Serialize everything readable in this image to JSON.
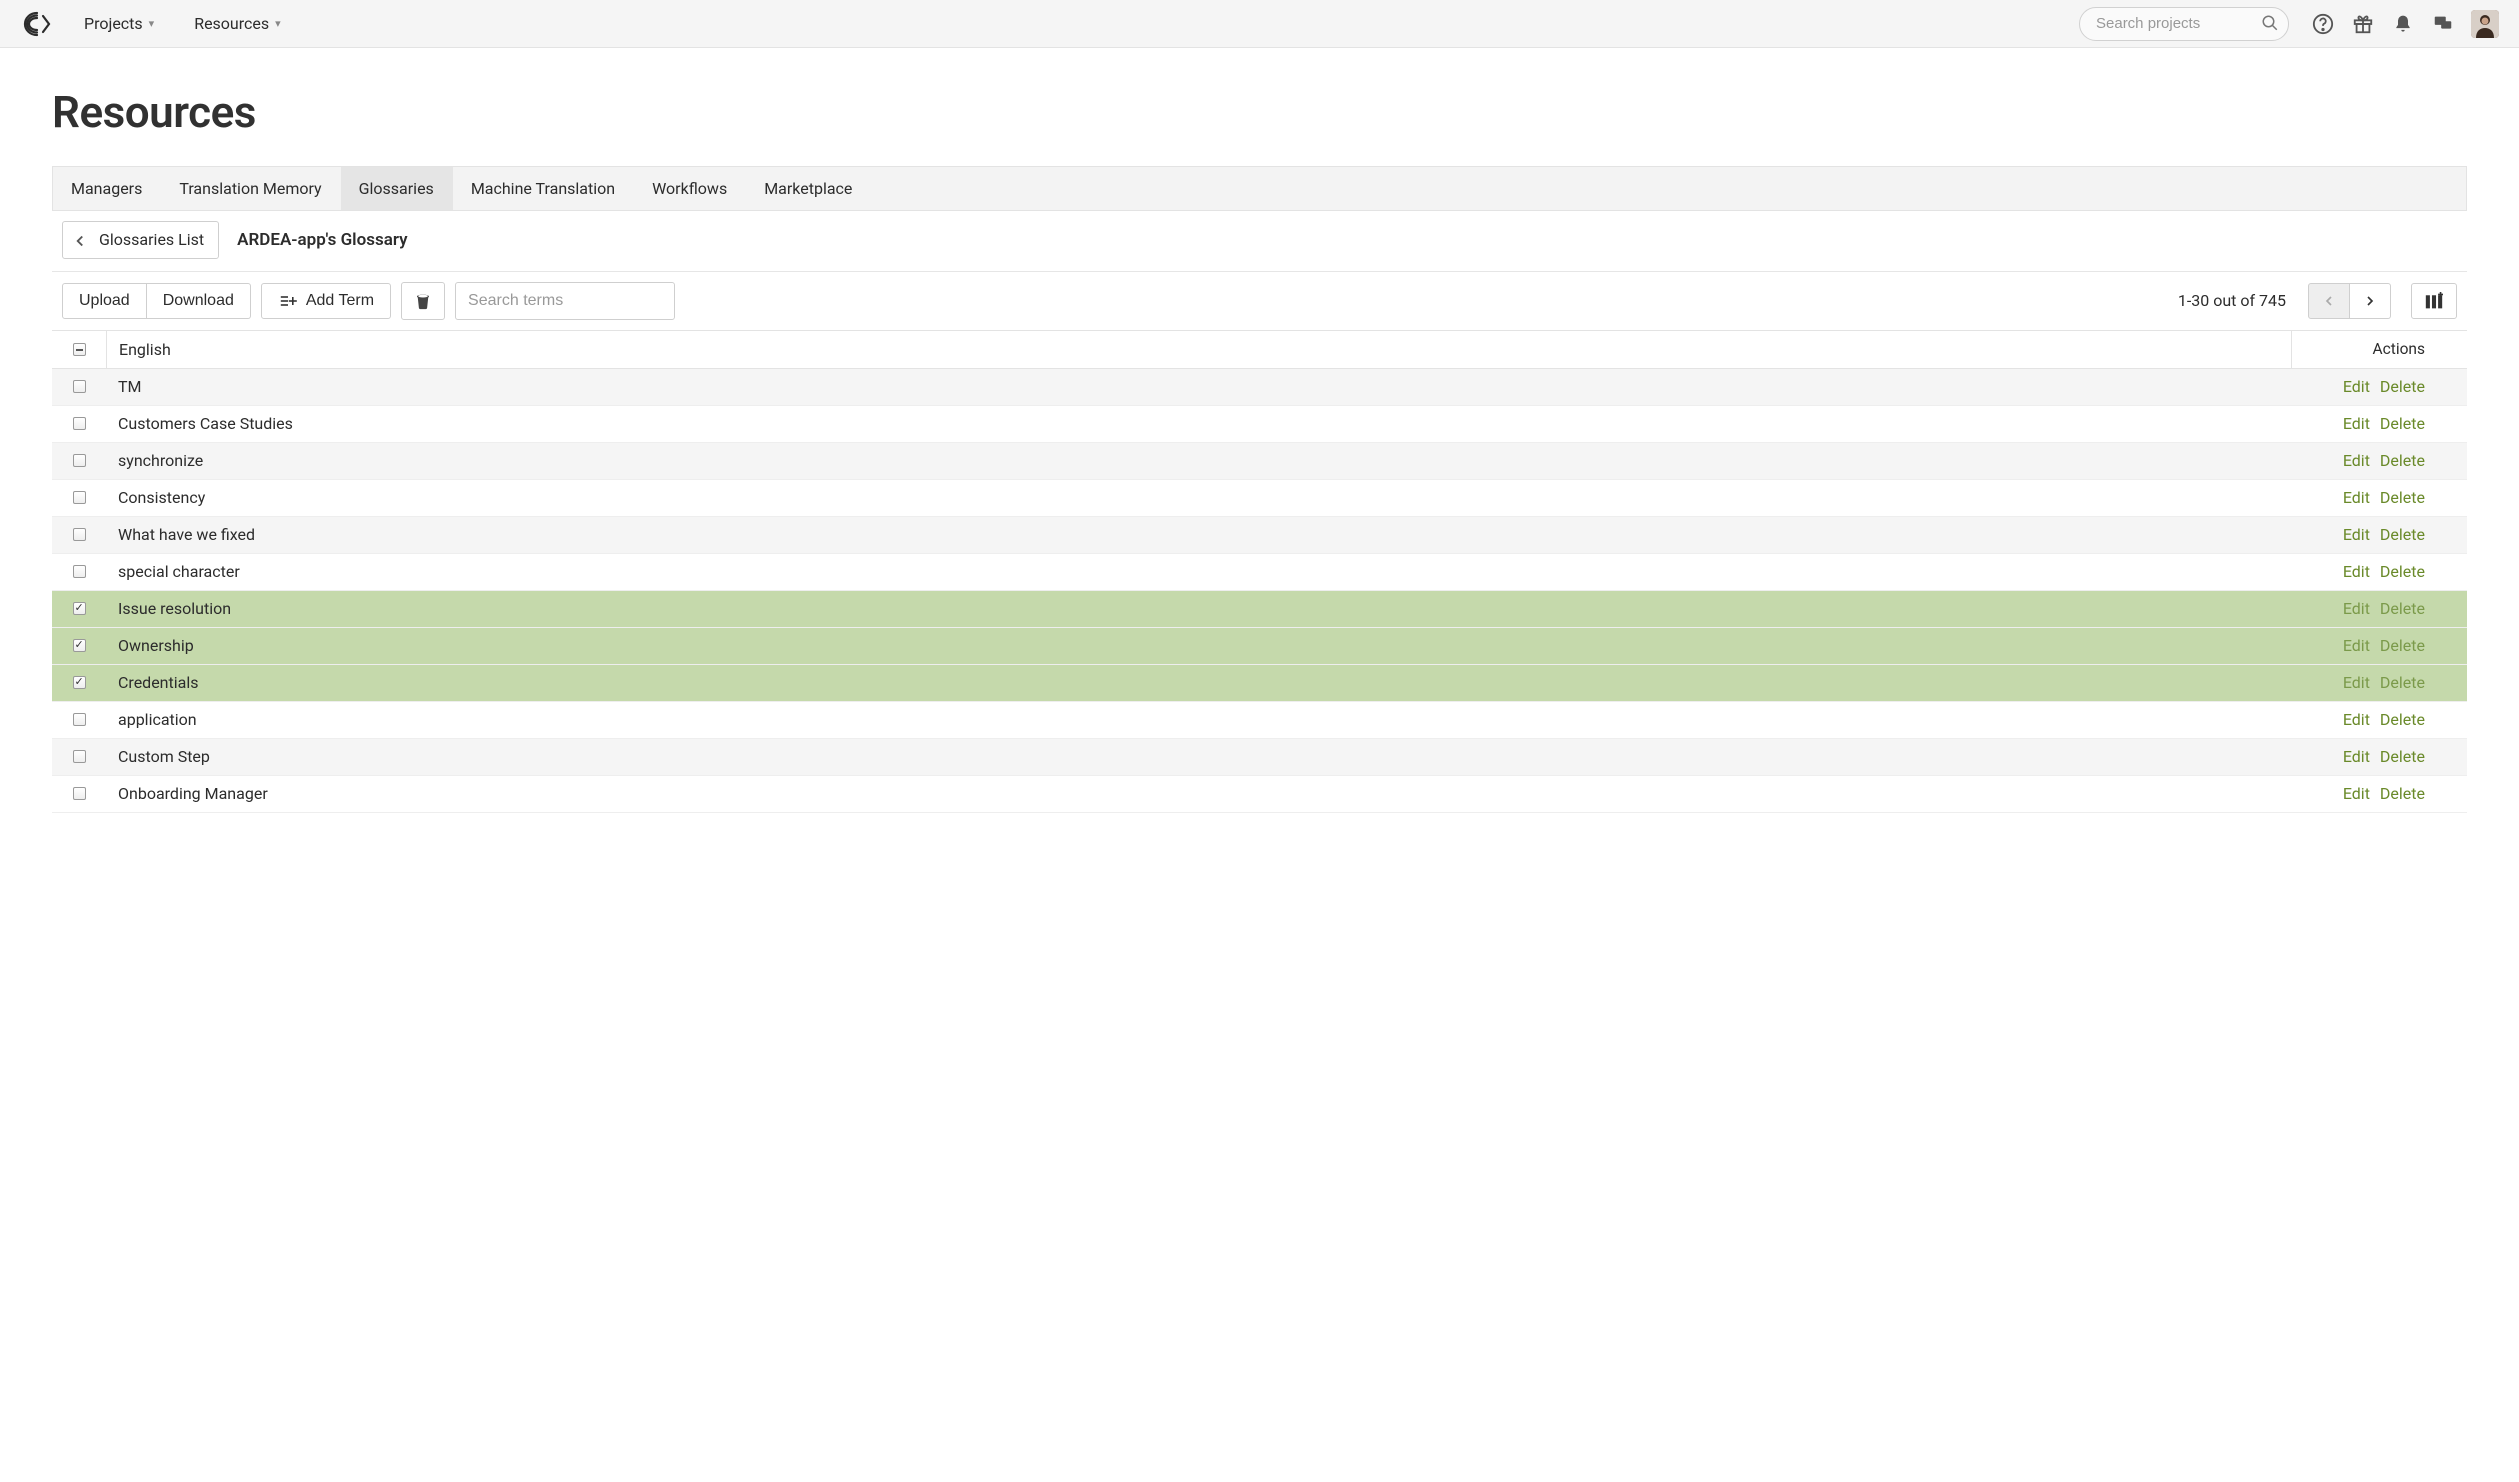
{
  "nav": {
    "projects": "Projects",
    "resources": "Resources"
  },
  "search": {
    "placeholder": "Search projects"
  },
  "page_title": "Resources",
  "tabs": [
    "Managers",
    "Translation Memory",
    "Glossaries",
    "Machine Translation",
    "Workflows",
    "Marketplace"
  ],
  "active_tab_index": 2,
  "breadcrumb": {
    "back_label": "Glossaries List",
    "current": "ARDEA-app's Glossary"
  },
  "toolbar": {
    "upload": "Upload",
    "download": "Download",
    "add_term": "Add Term",
    "search_placeholder": "Search terms",
    "pagination": "1-30 out of 745"
  },
  "table": {
    "header_main": "English",
    "header_actions": "Actions",
    "edit_label": "Edit",
    "delete_label": "Delete",
    "rows": [
      {
        "term": "TM",
        "selected": false
      },
      {
        "term": "Customers Case Studies",
        "selected": false
      },
      {
        "term": "synchronize",
        "selected": false
      },
      {
        "term": "Consistency",
        "selected": false
      },
      {
        "term": "What have we fixed",
        "selected": false
      },
      {
        "term": "special character",
        "selected": false
      },
      {
        "term": "Issue resolution",
        "selected": true
      },
      {
        "term": "Ownership",
        "selected": true
      },
      {
        "term": "Credentials",
        "selected": true
      },
      {
        "term": "application",
        "selected": false
      },
      {
        "term": "Custom Step",
        "selected": false
      },
      {
        "term": "Onboarding Manager",
        "selected": false
      }
    ]
  }
}
